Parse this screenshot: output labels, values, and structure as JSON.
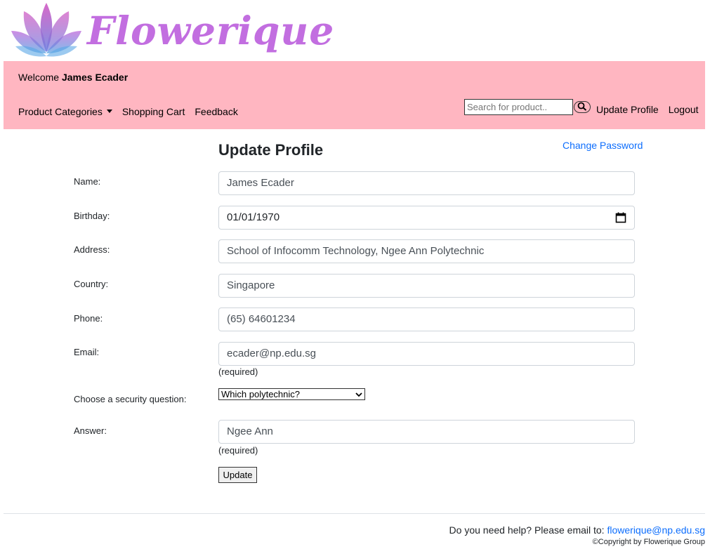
{
  "brand": {
    "name": "Flowerique",
    "logo_icon": "lotus-icon",
    "color": "#c26ee0"
  },
  "header": {
    "welcome_prefix": "Welcome",
    "user_name": "James Ecader",
    "background": "#ffb6c1"
  },
  "nav": {
    "product_categories": "Product Categories",
    "shopping_cart": "Shopping Cart",
    "feedback": "Feedback",
    "search_placeholder": "Search for product..",
    "search_icon": "search-icon",
    "update_profile": "Update Profile",
    "logout": "Logout"
  },
  "page": {
    "title": "Update Profile",
    "change_password": "Change Password"
  },
  "form": {
    "name_label": "Name:",
    "name_value": "James Ecader",
    "birthday_label": "Birthday:",
    "birthday_value": "01/01/1970",
    "address_label": "Address:",
    "address_value": "School of Infocomm Technology, Ngee Ann Polytechnic",
    "country_label": "Country:",
    "country_value": "Singapore",
    "phone_label": "Phone:",
    "phone_value": "(65) 64601234",
    "email_label": "Email:",
    "email_value": "ecader@np.edu.sg",
    "email_note": "(required)",
    "question_label": "Choose a security question:",
    "question_value": "Which polytechnic?",
    "answer_label": "Answer:",
    "answer_value": "Ngee Ann",
    "answer_note": "(required)",
    "update_button": "Update"
  },
  "footer": {
    "help_text": "Do you need help? Please email to:",
    "help_email": "flowerique@np.edu.sg",
    "copyright": "©Copyright by Flowerique Group"
  }
}
